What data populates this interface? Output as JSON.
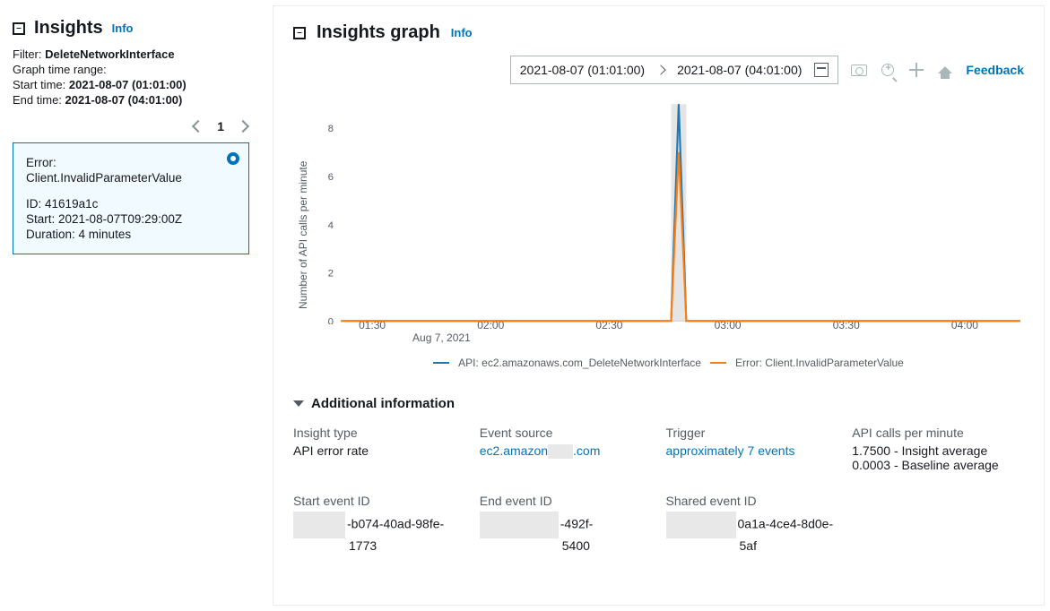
{
  "sidebar": {
    "title": "Insights",
    "info_label": "Info",
    "filter_label": "Filter:",
    "filter_value": "DeleteNetworkInterface",
    "range_label": "Graph time range:",
    "start_label": "Start time:",
    "start_value": "2021-08-07 (01:01:00)",
    "end_label": "End time:",
    "end_value": "2021-08-07 (04:01:00)",
    "page": "1",
    "card": {
      "line1": "Error:",
      "line2": "Client.InvalidParameterValue",
      "id_label": "ID:",
      "id_value": "41619a1c",
      "start_label": "Start:",
      "start_value": "2021-08-07T09:29:00Z",
      "dur_label": "Duration:",
      "dur_value": "4 minutes"
    }
  },
  "graph": {
    "title": "Insights graph",
    "info_label": "Info",
    "feedback": "Feedback",
    "range_start": "2021-08-07 (01:01:00)",
    "range_end": "2021-08-07 (04:01:00)",
    "ylabel": "Number of API calls per minute",
    "xdate": "Aug 7, 2021",
    "legend_api": "API: ec2.amazonaws.com_DeleteNetworkInterface",
    "legend_err": "Error: Client.InvalidParameterValue"
  },
  "chart_data": {
    "type": "line",
    "xlabel": "",
    "ylabel": "Number of API calls per minute",
    "ylim": [
      0,
      9
    ],
    "yticks": [
      0,
      2,
      4,
      6,
      8
    ],
    "x_ticks": [
      "01:30",
      "02:00",
      "02:30",
      "03:00",
      "03:30",
      "04:00"
    ],
    "x_date": "Aug 7, 2021",
    "highlight_band": {
      "start_min": 148,
      "end_min": 152
    },
    "series": [
      {
        "name": "API: ec2.amazonaws.com_DeleteNetworkInterface",
        "color": "#1f77b4",
        "points": [
          {
            "x_min": 61,
            "y": 0
          },
          {
            "x_min": 148,
            "y": 0
          },
          {
            "x_min": 150,
            "y": 9
          },
          {
            "x_min": 152,
            "y": 0
          },
          {
            "x_min": 240,
            "y": 0
          }
        ]
      },
      {
        "name": "Error: Client.InvalidParameterValue",
        "color": "#ff7f0e",
        "points": [
          {
            "x_min": 61,
            "y": 0
          },
          {
            "x_min": 148,
            "y": 0
          },
          {
            "x_min": 150,
            "y": 7
          },
          {
            "x_min": 152,
            "y": 0
          },
          {
            "x_min": 240,
            "y": 0
          }
        ]
      }
    ]
  },
  "additional": {
    "header": "Additional information",
    "insight_type": {
      "label": "Insight type",
      "value": "API error rate"
    },
    "event_source": {
      "label": "Event source",
      "value_prefix": "ec2.amazon",
      "value_suffix": ".com"
    },
    "trigger": {
      "label": "Trigger",
      "value": "approximately 7 events"
    },
    "api_calls": {
      "label": "API calls per minute",
      "line1": "1.7500 - Insight average",
      "line2": "0.0003 - Baseline average"
    },
    "start_event": {
      "label": "Start event ID",
      "suffix1": "-b074-40ad-98fe-",
      "suffix2": "1773"
    },
    "end_event": {
      "label": "End event ID",
      "suffix1": "-492f-",
      "suffix2": "5400"
    },
    "shared_event": {
      "label": "Shared event ID",
      "suffix1": "0a1a-4ce4-8d0e-",
      "suffix2": "5af"
    }
  }
}
